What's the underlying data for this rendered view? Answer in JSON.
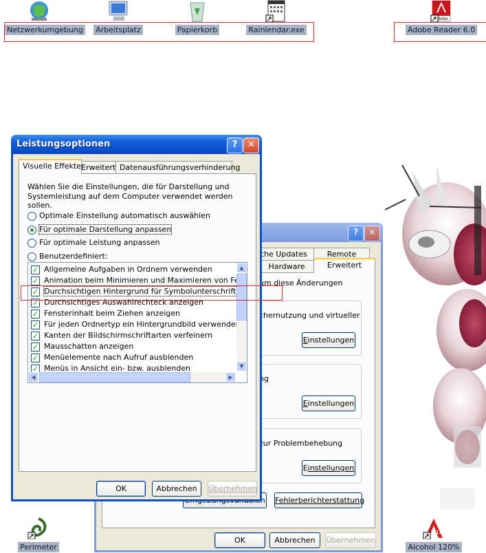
{
  "desktop": {
    "icons_top": [
      {
        "label": "Netzwerkumgebung",
        "icon": "network-icon"
      },
      {
        "label": "Arbeitsplatz",
        "icon": "computer-icon"
      },
      {
        "label": "Papierkorb",
        "icon": "recycle-bin-icon"
      },
      {
        "label": "Rainlendar.exe",
        "icon": "calendar-icon"
      },
      {
        "label": "Adobe Reader 6.0",
        "icon": "adobe-reader-icon"
      }
    ],
    "icons_bottom": [
      {
        "label": "Perimeter",
        "icon": "perimeter-icon"
      },
      {
        "label": "Alcohol 120%",
        "icon": "alcohol-icon"
      }
    ],
    "alcohol_icon_text": "120%",
    "adobe_icon_text": "Adobe"
  },
  "sysprops": {
    "tabs": [
      "che Updates",
      "Remote",
      "Hardware",
      "Erweitert"
    ],
    "text_change": "um diese Änderungen",
    "text_perf": "chernutzung und virtueller",
    "text_profiles": "ng",
    "text_startup": "zur Problembehebung",
    "settings_label": "Einstellungen",
    "settings_mnemonic": "E",
    "settings_rest": "instellungen",
    "startup_settings_label": "instellungen",
    "env_button": "Umgebungsvariablen",
    "error_button": "Fehlerberichterstattung",
    "ok": "OK",
    "cancel": "Abbrechen",
    "apply": "Übernehmen"
  },
  "perf": {
    "title": "Leistungsoptionen",
    "tabs": [
      "Visuelle Effekte",
      "Erweitert",
      "Datenausführungsverhinderung"
    ],
    "intro_line1": "Wählen Sie die Einstellungen, die für Darstellung und",
    "intro_line2": "Systemleistung auf dem Computer verwendet werden sollen.",
    "radios": [
      {
        "label": "Optimale Einstellung automatisch auswählen",
        "checked": false
      },
      {
        "label": "Für optimale Darstellung anpassen",
        "checked": true
      },
      {
        "label": "Für optimale Leistung anpassen",
        "checked": false
      },
      {
        "label": "Benutzerdefiniert:",
        "checked": false
      }
    ],
    "options": [
      {
        "label": "Allgemeine Aufgaben in Ordnern verwenden",
        "checked": true
      },
      {
        "label": "Animation beim Minimieren und Maximieren von Fenstern",
        "checked": true
      },
      {
        "label": "Durchsichtigen Hintergrund für Symbolunterschriften auf dem Desktop",
        "checked": true
      },
      {
        "label": "Durchsichtiges Auswahlrechteck anzeigen",
        "checked": true
      },
      {
        "label": "Fensterinhalt beim Ziehen anzeigen",
        "checked": true
      },
      {
        "label": "Für jeden Ordnertyp ein Hintergrundbild verwenden",
        "checked": true
      },
      {
        "label": "Kanten der Bildschirmschriftarten verfeinern",
        "checked": true
      },
      {
        "label": "Mausschatten anzeigen",
        "checked": true
      },
      {
        "label": "Menüelemente nach Aufruf ausblenden",
        "checked": true
      },
      {
        "label": "Menüs in Ansicht ein- bzw. ausblenden",
        "checked": true
      }
    ],
    "ok": "OK",
    "cancel": "Abbrechen",
    "apply": "Übernehmen"
  },
  "colors": {
    "highlight_box": "#d8262c",
    "xp_blue": "#0a50c6",
    "dialog_bg": "#ece9d8"
  }
}
